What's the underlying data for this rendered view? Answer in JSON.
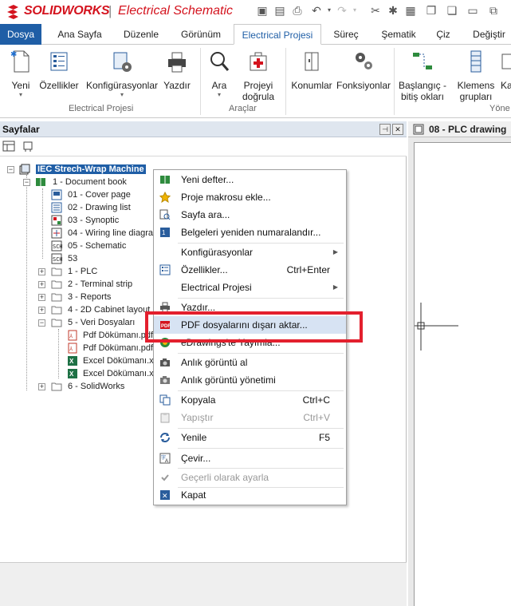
{
  "titlebar": {
    "brand": "SOLIDWORKS",
    "separator": "|",
    "app_name": "Electrical Schematic"
  },
  "tabs": [
    {
      "label": "Dosya"
    },
    {
      "label": "Ana Sayfa"
    },
    {
      "label": "Düzenle"
    },
    {
      "label": "Görünüm"
    },
    {
      "label": "Electrical Projesi"
    },
    {
      "label": "Süreç"
    },
    {
      "label": "Şematik"
    },
    {
      "label": "Çiz"
    },
    {
      "label": "Değiştir"
    }
  ],
  "ribbon": {
    "buttons": [
      {
        "label": "Yeni"
      },
      {
        "label": "Özellikler"
      },
      {
        "label": "Konfigürasyonlar"
      },
      {
        "label": "Yazdır"
      },
      {
        "label": "Ara"
      },
      {
        "label": "Projeyi doğrula"
      },
      {
        "label": "Konumlar"
      },
      {
        "label": "Fonksiyonlar"
      },
      {
        "label": "Başlangıç - bitiş okları"
      },
      {
        "label": "Klemens grupları"
      },
      {
        "label": "Ka"
      }
    ],
    "groups": [
      {
        "label": "Electrical Projesi"
      },
      {
        "label": "Araçlar"
      },
      {
        "label": "Yöne"
      }
    ]
  },
  "pane": {
    "title": "Sayfalar",
    "pin": "⊣",
    "close": "✕"
  },
  "tree": {
    "root": "IEC Strech-Wrap Machine",
    "items": [
      {
        "label": "1 - Document book"
      },
      {
        "label": "01 - Cover page"
      },
      {
        "label": "02 - Drawing list"
      },
      {
        "label": "03 - Synoptic"
      },
      {
        "label": "04 - Wiring line diagram"
      },
      {
        "label": "05 - Schematic"
      },
      {
        "label": "53"
      },
      {
        "label": "1 - PLC"
      },
      {
        "label": "2 - Terminal strip"
      },
      {
        "label": "3 - Reports"
      },
      {
        "label": "4 - 2D Cabinet layout"
      },
      {
        "label": "5 - Veri Dosyaları"
      },
      {
        "label": "Pdf Dökümanı.pdf"
      },
      {
        "label": "Pdf Dökümanı.pdf"
      },
      {
        "label": "Excel Dökümanı.xlsx"
      },
      {
        "label": "Excel Dökümanı.xlsx"
      },
      {
        "label": "6 - SolidWorks"
      }
    ]
  },
  "drawing": {
    "title": "08 - PLC drawing"
  },
  "context_menu": {
    "items": [
      {
        "label": "Yeni defter...",
        "shortcut": ""
      },
      {
        "label": "Proje makrosu ekle...",
        "shortcut": ""
      },
      {
        "label": "Sayfa ara...",
        "shortcut": ""
      },
      {
        "label": "Belgeleri yeniden numaralandır...",
        "shortcut": ""
      },
      {
        "label": "Konfigürasyonlar",
        "shortcut": ""
      },
      {
        "label": "Özellikler...",
        "shortcut": "Ctrl+Enter"
      },
      {
        "label": "Electrical Projesi",
        "shortcut": ""
      },
      {
        "label": "Yazdır...",
        "shortcut": ""
      },
      {
        "label": "PDF dosyalarını dışarı aktar...",
        "shortcut": ""
      },
      {
        "label": "eDrawings'te Yayımla...",
        "shortcut": ""
      },
      {
        "label": "Anlık görüntü al",
        "shortcut": ""
      },
      {
        "label": "Anlık görüntü yönetimi",
        "shortcut": ""
      },
      {
        "label": "Kopyala",
        "shortcut": "Ctrl+C"
      },
      {
        "label": "Yapıştır",
        "shortcut": "Ctrl+V"
      },
      {
        "label": "Yenile",
        "shortcut": "F5"
      },
      {
        "label": "Çevir...",
        "shortcut": ""
      },
      {
        "label": "Geçerli olarak ayarla",
        "shortcut": ""
      },
      {
        "label": "Kapat",
        "shortcut": ""
      }
    ]
  },
  "colors": {
    "brand_red": "#d4131e",
    "file_tab": "#1f5ea6",
    "selection": "#1f5ea6",
    "highlight_box": "#e3202e",
    "menu_hover": "#d7e3f3"
  }
}
